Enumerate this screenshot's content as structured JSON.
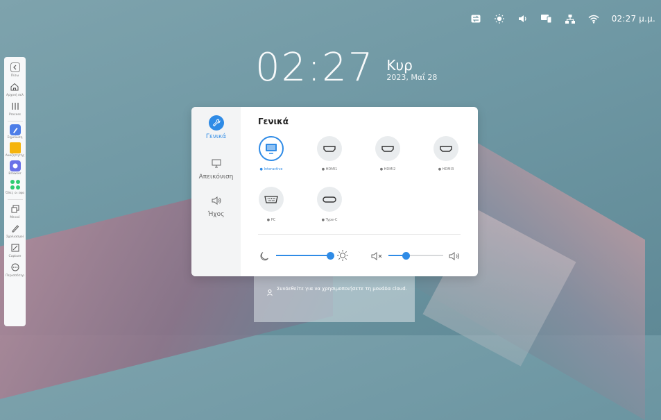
{
  "status_bar": {
    "icons": [
      "input-switch-icon",
      "brightness-icon",
      "volume-icon",
      "screen-share-icon",
      "network-icon",
      "wifi-icon"
    ],
    "time": "02:27 μ.μ."
  },
  "clock": {
    "time": "02:27",
    "day": "Κυρ",
    "date": "2023, Μαΐ 28"
  },
  "sidebar": {
    "items": [
      {
        "label": "Πίσω"
      },
      {
        "label": "Αρχική σελ"
      },
      {
        "label": "Process"
      },
      {
        "label": "Σημείωση"
      },
      {
        "label": "Αναζητητής"
      },
      {
        "label": "Browser"
      },
      {
        "label": "Όλες οι εφα"
      },
      {
        "label": "Μενού"
      },
      {
        "label": "Σχολιασμοί"
      },
      {
        "label": "Capture"
      },
      {
        "label": "Περισσότερ"
      }
    ]
  },
  "settings": {
    "nav": [
      {
        "label": "Γενικά",
        "active": true
      },
      {
        "label": "Απεικόνιση",
        "active": false
      },
      {
        "label": "Ήχος",
        "active": false
      }
    ],
    "title": "Γενικά",
    "sources": [
      {
        "label": "Interactive",
        "active": true
      },
      {
        "label": "HDMI1",
        "active": false
      },
      {
        "label": "HDMI2",
        "active": false
      },
      {
        "label": "HDMI3",
        "active": false
      },
      {
        "label": "PC",
        "active": false
      },
      {
        "label": "Type-C",
        "active": false
      }
    ],
    "brightness_level": 1.0,
    "volume_level": 0.33
  },
  "cloud": {
    "message": "Συνδεθείτε για να χρησιμοποιήσετε τη μονάδα cloud."
  },
  "colors": {
    "accent": "#2f8be6",
    "panel": "#ffffff",
    "nav_bg": "#f3f4f5"
  }
}
